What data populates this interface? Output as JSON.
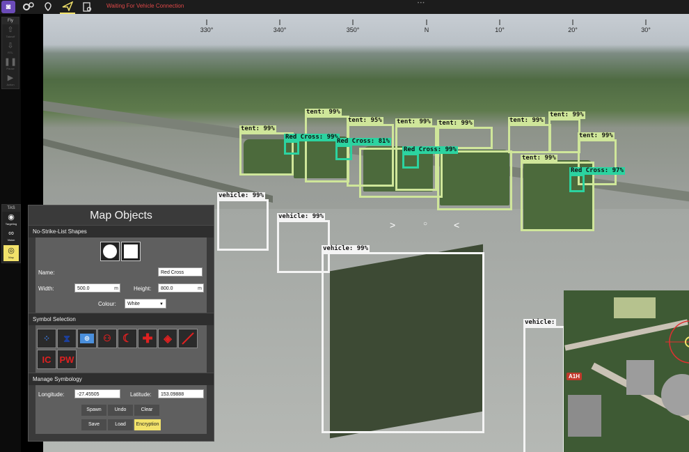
{
  "toolbar": {
    "status": "Waiting For Vehicle Connection",
    "icons": [
      "app-logo-icon",
      "settings-icon",
      "plan-icon",
      "fly-icon",
      "analyze-icon"
    ]
  },
  "rail": {
    "fly_header": "Fly",
    "fly_items": [
      {
        "label": "Takeoff",
        "icon": "takeoff-icon"
      },
      {
        "label": "RTL",
        "icon": "rtl-icon"
      },
      {
        "label": "Pause",
        "icon": "pause-icon"
      },
      {
        "label": "Action",
        "icon": "action-icon"
      }
    ],
    "tas_header": "TAS",
    "tas_items": [
      {
        "label": "Targeting",
        "icon": "eye-icon"
      },
      {
        "label": "Vision",
        "icon": "binoculars-icon"
      },
      {
        "label": "Map",
        "icon": "map-target-icon"
      }
    ]
  },
  "compass": {
    "labels": [
      "330°",
      "340°",
      "350°",
      "N",
      "10°",
      "20°",
      "30°"
    ]
  },
  "detections": {
    "tents": [
      {
        "label": "tent: 99%"
      },
      {
        "label": "tent: 99%"
      },
      {
        "label": "tent: 95%"
      },
      {
        "label": "tent: 99%"
      },
      {
        "label": "tent: 99%"
      },
      {
        "label": "tent: 99%"
      },
      {
        "label": "tent: 99%"
      },
      {
        "label": "tent: 99%"
      },
      {
        "label": "tent: 99%"
      }
    ],
    "red_cross": [
      {
        "label": "Red Cross: 99%"
      },
      {
        "label": "Red Cross: 81%"
      },
      {
        "label": "Red Cross: 99%"
      },
      {
        "label": "Red Cross: 97%"
      }
    ],
    "vehicles": [
      {
        "label": "vehicle: 99%"
      },
      {
        "label": "vehicle: 99%"
      },
      {
        "label": "vehicle: 99%"
      },
      {
        "label": "vehicle:"
      }
    ]
  },
  "minimap": {
    "label": "A1H"
  },
  "panel": {
    "title": "Map Objects",
    "shapes_header": "No-Strike-List Shapes",
    "name_label": "Name:",
    "name_value": "Red Cross",
    "width_label": "Width:",
    "width_value": "500.0",
    "width_unit": "m",
    "height_label": "Height:",
    "height_value": "800.0",
    "height_unit": "m",
    "colour_label": "Colour:",
    "colour_value": "White",
    "symbol_header": "Symbol Selection",
    "symbols": [
      {
        "icon": "dots-symbol-icon"
      },
      {
        "icon": "hourglass-symbol-icon"
      },
      {
        "icon": "un-emblem-icon"
      },
      {
        "icon": "cultural-property-icon"
      },
      {
        "icon": "red-crescent-icon"
      },
      {
        "icon": "red-cross-icon"
      },
      {
        "icon": "red-crystal-icon"
      },
      {
        "icon": "diagonal-line-icon"
      }
    ],
    "symbols_text": [
      "IC",
      "PW"
    ],
    "manage_header": "Manage Symbology",
    "longitude_label": "Longitude:",
    "longitude_value": "-27.45505",
    "latitude_label": "Latitude:",
    "latitude_value": "153.09888",
    "buttons": {
      "spawn": "Spawn",
      "undo": "Undo",
      "clear": "Clear",
      "save": "Save",
      "load": "Load",
      "encryption": "Encryption"
    }
  },
  "colors": {
    "accent": "#f2e26a",
    "tent_box": "#cfe69a",
    "redcross_box": "#2cd3a0",
    "vehicle_box": "#f4f4f4",
    "status": "#e04848"
  }
}
